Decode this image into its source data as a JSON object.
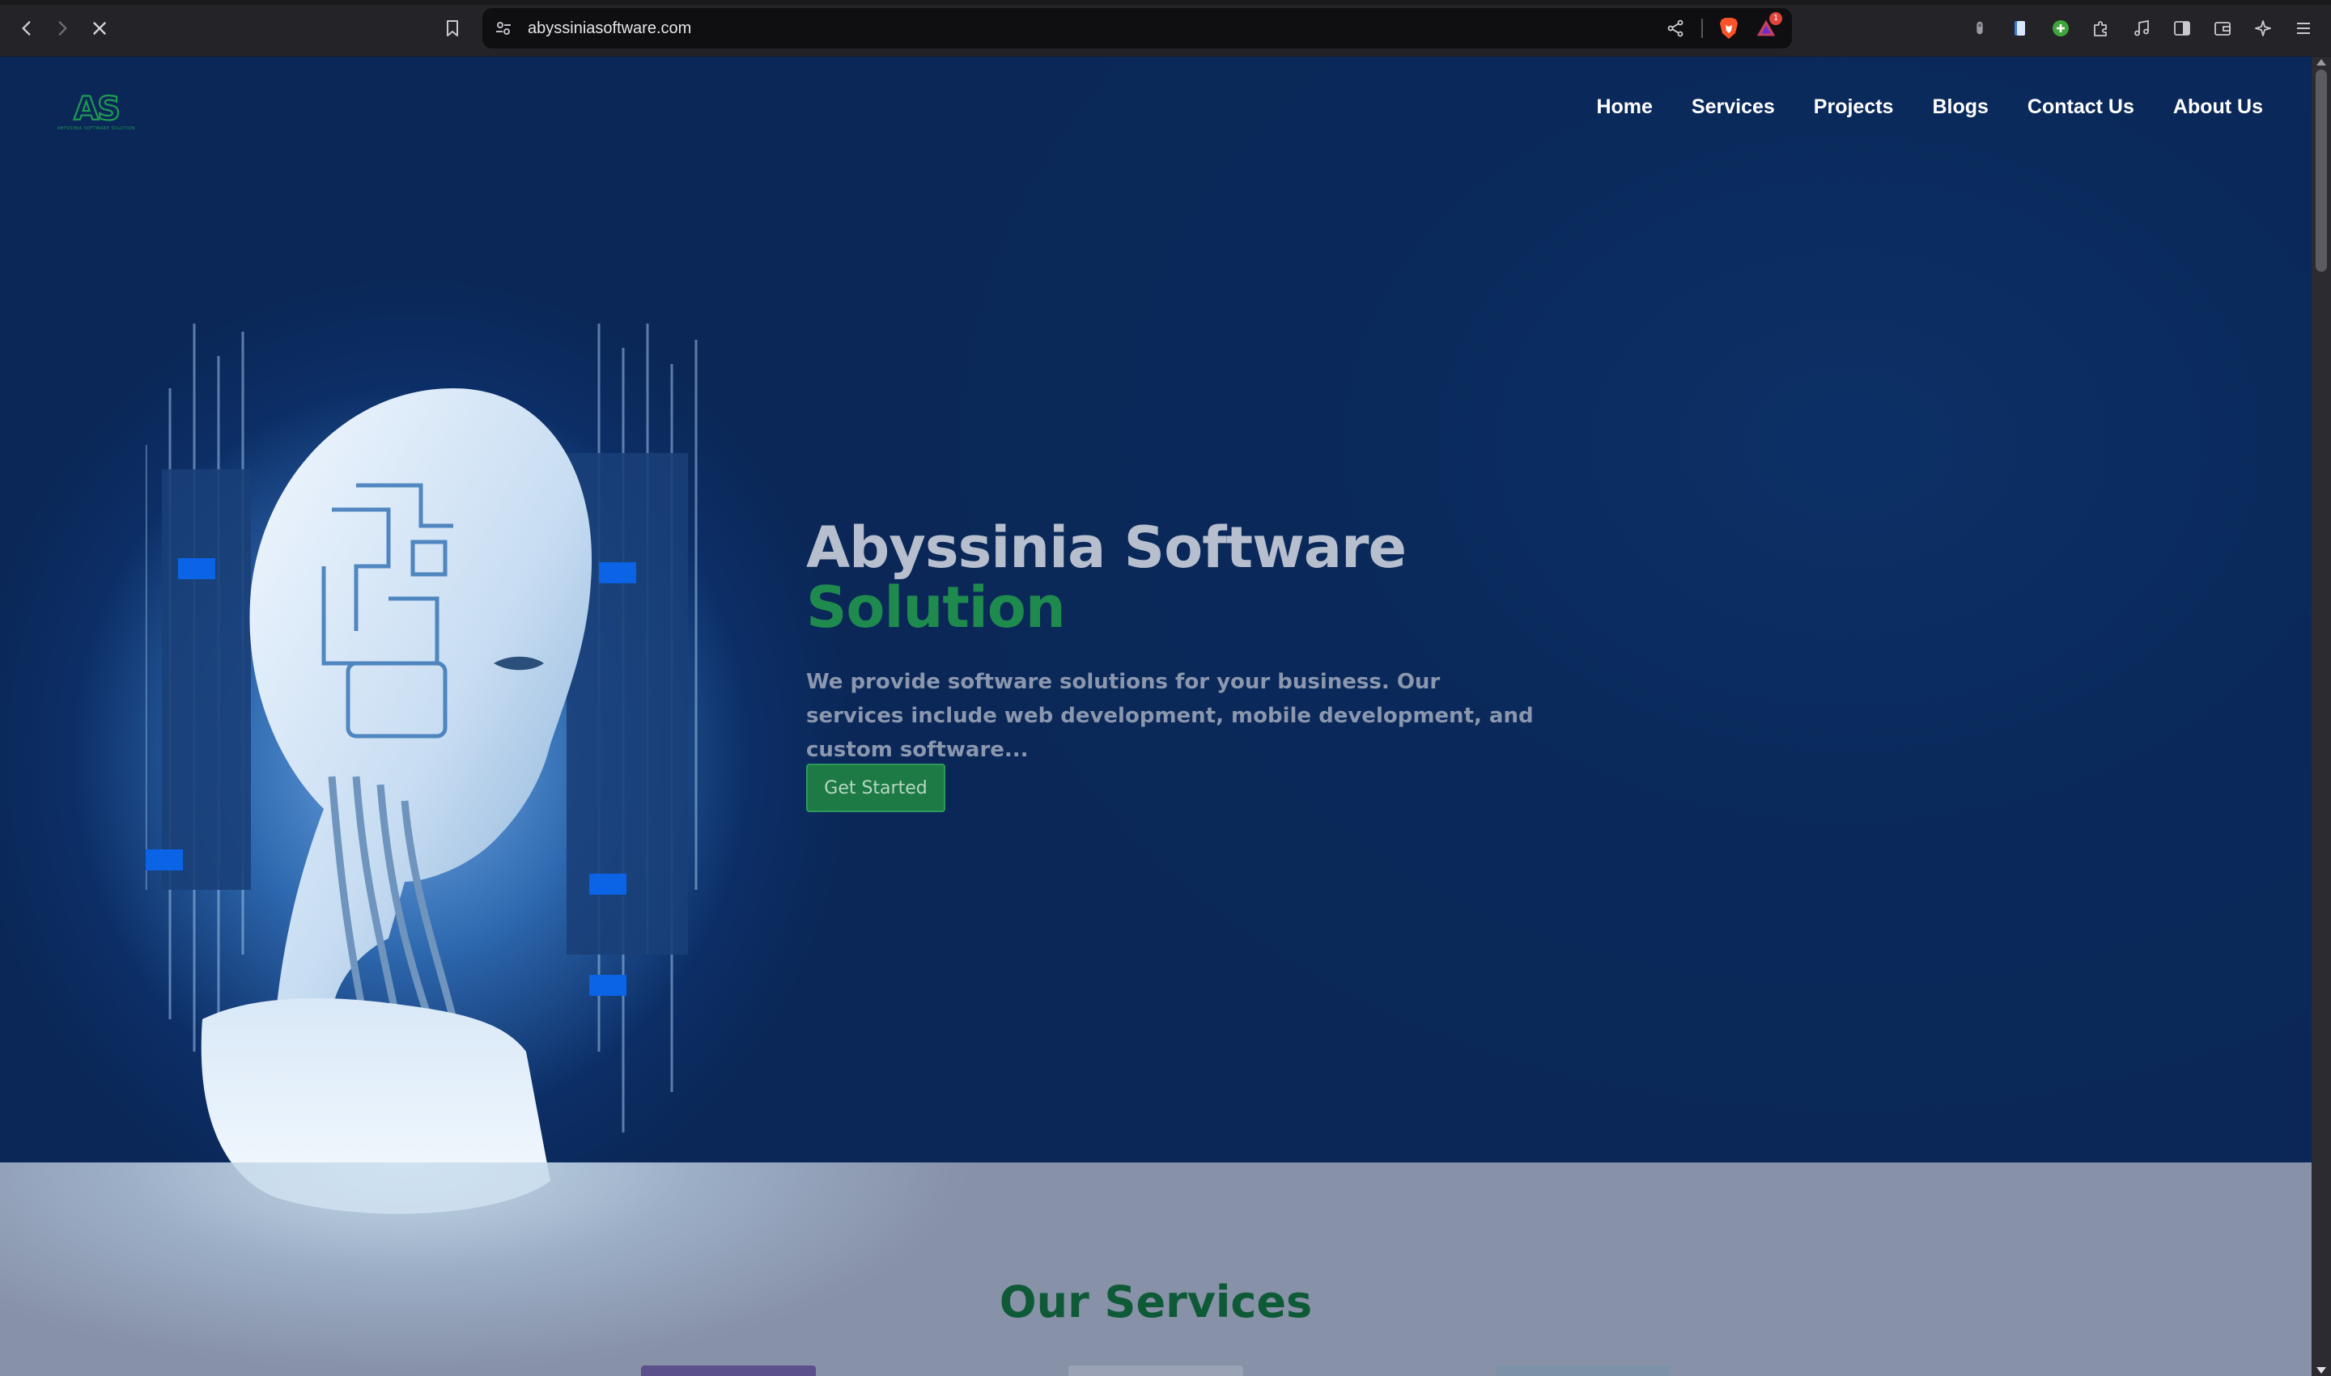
{
  "browser": {
    "url": "abyssiniasoftware.com",
    "rewards_badge": "1",
    "icons": {
      "back": "chevron-left-icon",
      "forward": "chevron-right-icon",
      "stop": "close-icon",
      "bookmark": "bookmark-icon",
      "site_info": "site-settings-icon",
      "share": "share-icon",
      "shields": "brave-shields-icon",
      "rewards": "brave-rewards-icon"
    },
    "extensions": [
      "extension-a-icon",
      "notes-icon",
      "plus-circle-icon",
      "puzzle-icon",
      "music-icon",
      "sidebar-icon",
      "wallet-icon",
      "leo-ai-icon",
      "menu-icon"
    ]
  },
  "site": {
    "logo_text": "AS",
    "logo_subtext": "ABYSSINIA SOFTWARE SOLUTION",
    "nav": [
      "Home",
      "Services",
      "Projects",
      "Blogs",
      "Contact Us",
      "About Us"
    ],
    "hero": {
      "title": "Abyssinia Software",
      "title_accent": "Solution",
      "description": "We provide software solutions for your business. Our services include web development, mobile development, and custom software...",
      "cta": "Get Started"
    },
    "services_title": "Our Services"
  },
  "colors": {
    "hero_bg": "#0a2757",
    "accent_green": "#1f8a4e",
    "services_heading": "#0e5a36",
    "section_bg": "#8791a7"
  }
}
